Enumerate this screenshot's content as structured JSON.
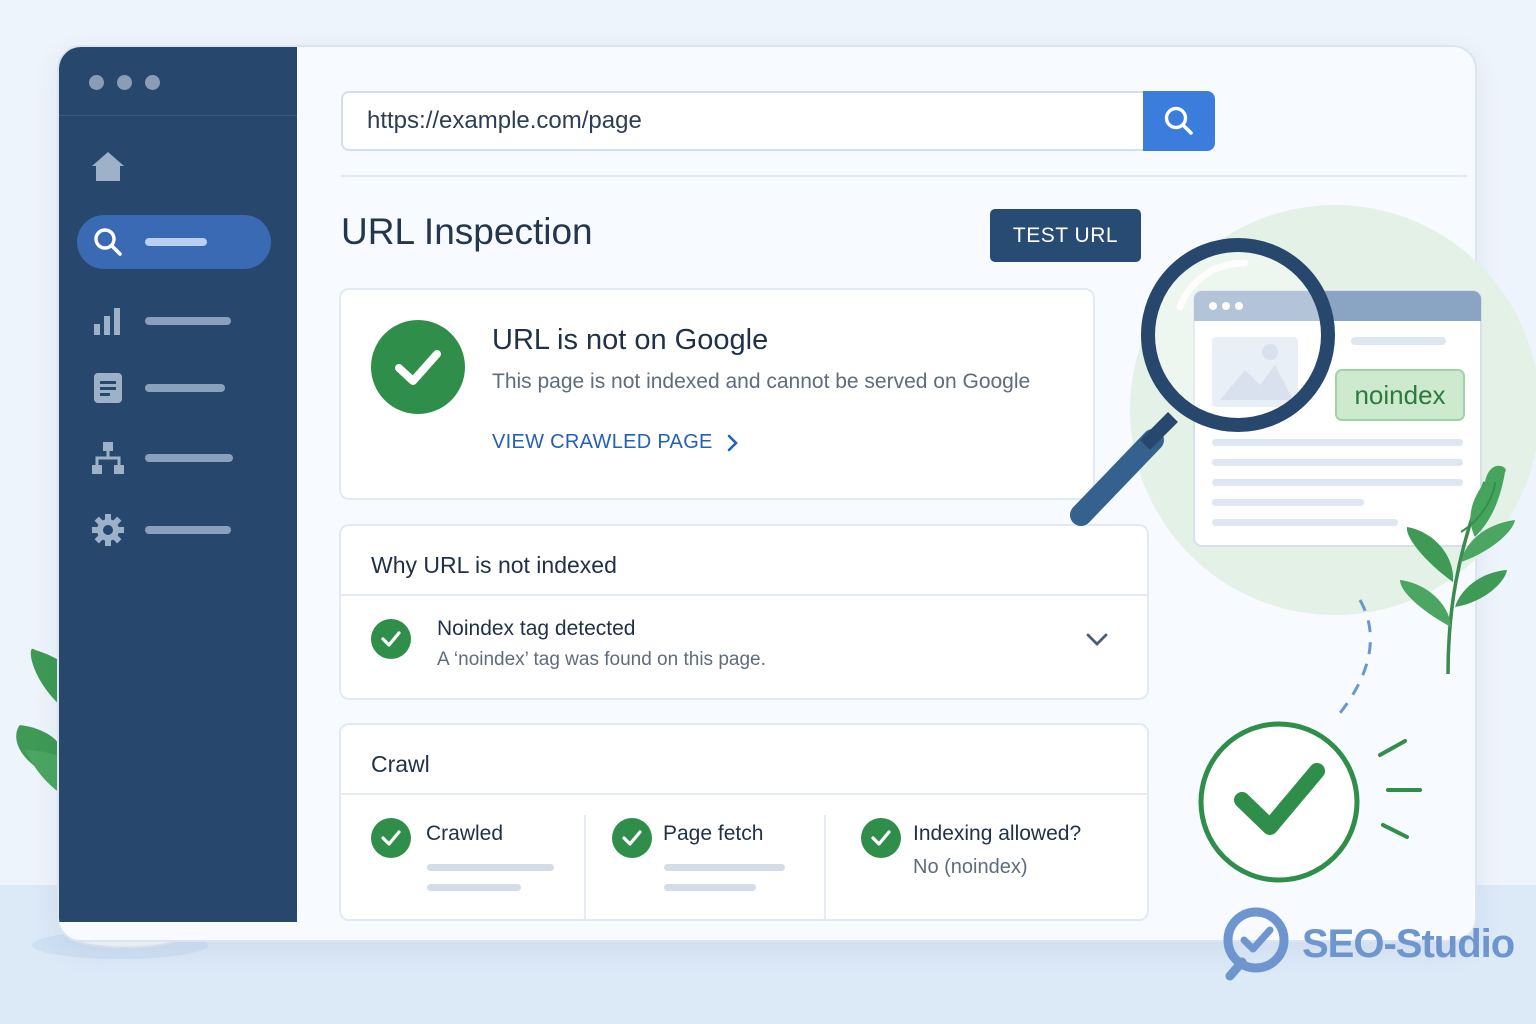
{
  "sidebar": {
    "items": [
      {
        "icon": "home-icon"
      },
      {
        "icon": "search-icon",
        "active": true
      },
      {
        "icon": "bar-chart-icon"
      },
      {
        "icon": "document-icon"
      },
      {
        "icon": "sitemap-icon"
      },
      {
        "icon": "gear-icon"
      }
    ]
  },
  "search": {
    "value": "https://example.com/page",
    "button_icon": "search-icon"
  },
  "header": {
    "title": "URL Inspection",
    "test_button": "TEST URL"
  },
  "status_card": {
    "title": "URL is not on Google",
    "description": "This page is not indexed and cannot be served on Google",
    "link": "VIEW CRAWLED PAGE"
  },
  "why_card": {
    "heading": "Why URL is not indexed",
    "reason_title": "Noindex tag detected",
    "reason_description": "A ‘noindex’ tag was found on this page."
  },
  "crawl_card": {
    "heading": "Crawl",
    "columns": [
      {
        "label": "Crawled"
      },
      {
        "label": "Page fetch"
      },
      {
        "label": "Indexing allowed?",
        "value": "No (noindex)"
      }
    ]
  },
  "illustration": {
    "tag": "noindex"
  },
  "brand": {
    "name": "SEO-Studio"
  },
  "colors": {
    "sidebar": "#27476d",
    "accent_blue": "#3b7ddd",
    "success_green": "#2f8e4a",
    "link_blue": "#2360b6"
  }
}
